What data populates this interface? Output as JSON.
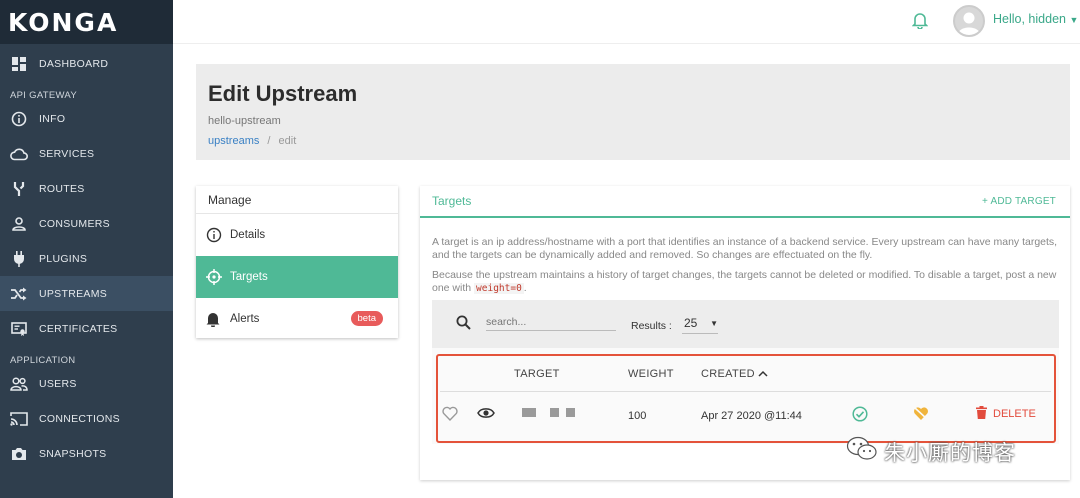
{
  "app": {
    "logo": "KONGA"
  },
  "sidebar": {
    "items": [
      {
        "label": "DASHBOARD",
        "icon": "dashboard-icon"
      },
      {
        "section": "API GATEWAY"
      },
      {
        "label": "INFO",
        "icon": "info-icon"
      },
      {
        "label": "SERVICES",
        "icon": "cloud-icon"
      },
      {
        "label": "ROUTES",
        "icon": "fork-icon"
      },
      {
        "label": "CONSUMERS",
        "icon": "person-icon"
      },
      {
        "label": "PLUGINS",
        "icon": "plug-icon"
      },
      {
        "label": "UPSTREAMS",
        "icon": "shuffle-icon",
        "active": true
      },
      {
        "label": "CERTIFICATES",
        "icon": "certificate-icon"
      },
      {
        "section": "APPLICATION"
      },
      {
        "label": "USERS",
        "icon": "users-icon"
      },
      {
        "label": "CONNECTIONS",
        "icon": "cast-icon"
      },
      {
        "label": "SNAPSHOTS",
        "icon": "camera-icon"
      }
    ]
  },
  "topbar": {
    "greeting": "Hello, hidden"
  },
  "header": {
    "title": "Edit Upstream",
    "upstream_name": "hello-upstream",
    "breadcrumb": {
      "link": "upstreams",
      "separator": "/",
      "current": "edit"
    }
  },
  "manage": {
    "title": "Manage",
    "items": [
      {
        "label": "Details",
        "icon": "info-icon"
      },
      {
        "label": "Targets",
        "icon": "crosshair-icon",
        "active": true
      },
      {
        "label": "Alerts",
        "icon": "bell-icon",
        "badge": "beta"
      }
    ]
  },
  "targets": {
    "title": "Targets",
    "add_label": "+ ADD TARGET",
    "desc1": "A target is an ip address/hostname with a port that identifies an instance of a backend service. Every upstream can have many targets, and the targets can be dynamically added and removed. So changes are effectuated on the fly.",
    "desc2_before": "Because the upstream maintains a history of target changes, the targets cannot be deleted or modified. To disable a target, post a new one with ",
    "desc2_code": "weight=0",
    "desc2_after": ".",
    "search_placeholder": "search...",
    "results_label": "Results :",
    "results_value": "25",
    "columns": {
      "target": "TARGET",
      "weight": "WEIGHT",
      "created": "CREATED"
    },
    "row": {
      "weight": "100",
      "created": "Apr 27 2020 @11:44",
      "delete": "DELETE"
    }
  },
  "watermark": {
    "text": "朱小厮的博客"
  },
  "colors": {
    "accent": "#4fb996",
    "sidebar": "#2f3e4d",
    "danger": "#e24b3c"
  }
}
